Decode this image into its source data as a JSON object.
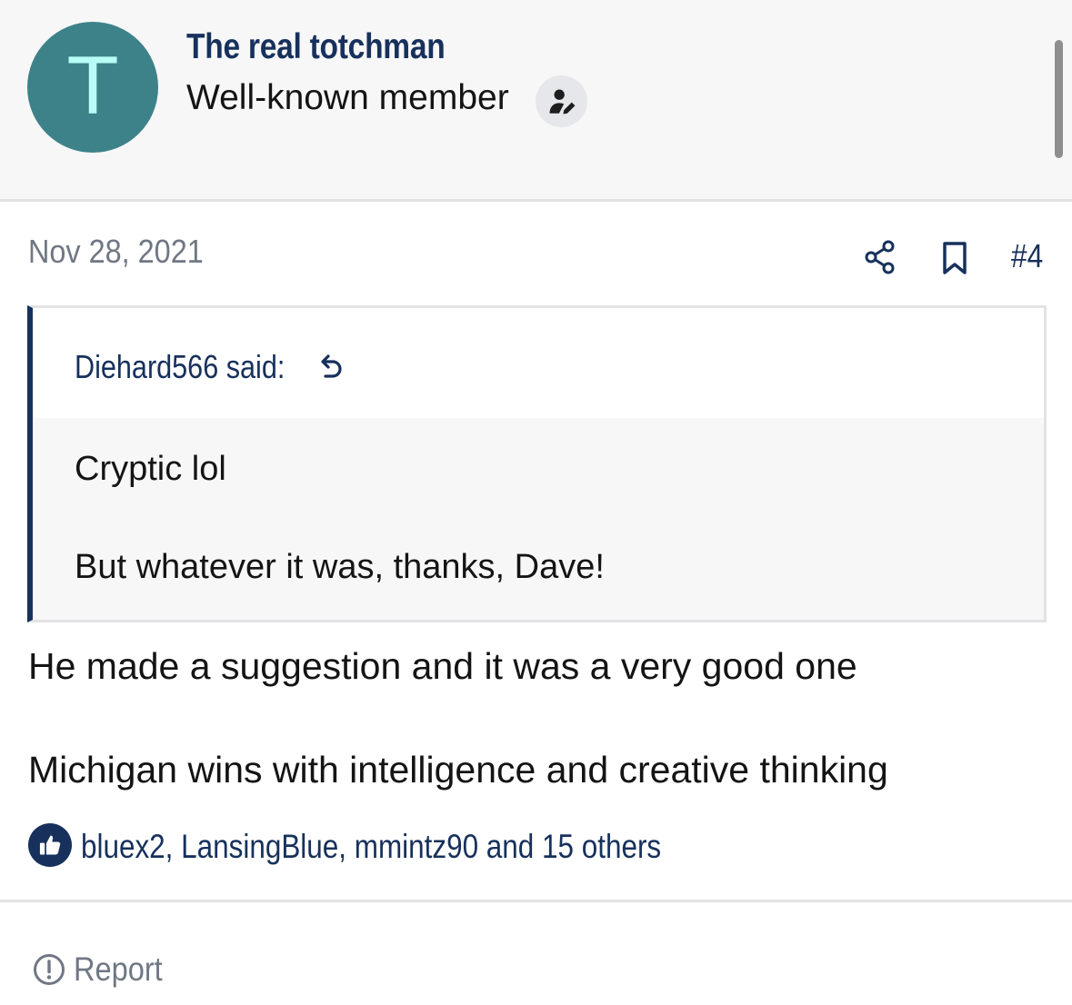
{
  "author": {
    "avatar_letter": "T",
    "avatar_color": "#3d8289",
    "name": "The real totchman",
    "title": "Well-known member",
    "badge_icon": "user-edit-icon"
  },
  "post": {
    "date": "Nov 28, 2021",
    "number": "#4",
    "actions": [
      "share-icon",
      "bookmark-icon"
    ]
  },
  "quote": {
    "author_label": "Diehard566 said:",
    "jump_icon": "undo-arrow-icon",
    "lines": [
      "Cryptic lol",
      "But whatever it was, thanks, Dave!"
    ]
  },
  "body": {
    "lines": [
      "He made a suggestion and it was a very good one",
      "Michigan wins with intelligence and creative thinking"
    ]
  },
  "reactions": {
    "icon": "thumbs-up-icon",
    "text": "bluex2, LansingBlue, mmintz90 and 15 others"
  },
  "footer": {
    "report_icon": "alert-circle-icon",
    "report_label": "Report"
  },
  "colors": {
    "accent": "#17315c",
    "muted": "#707784",
    "header_bg": "#f7f7f8"
  }
}
